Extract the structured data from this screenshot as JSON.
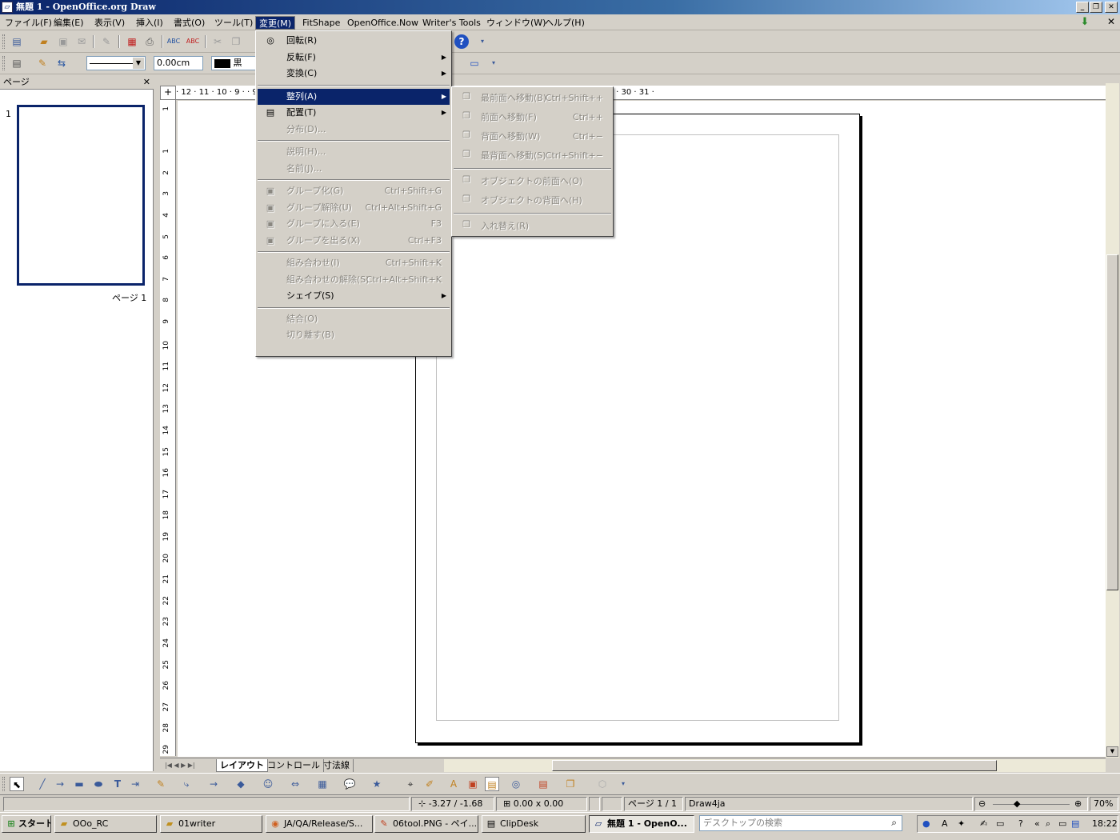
{
  "window": {
    "title": "無題 1 - OpenOffice.org Draw",
    "min": "_",
    "restore": "❐",
    "close": "✕",
    "doc_close": "✕"
  },
  "menubar": [
    "ファイル(F)",
    "編集(E)",
    "表示(V)",
    "挿入(I)",
    "書式(O)",
    "ツール(T)",
    "変更(M)",
    "FitShape",
    "OpenOffice.Now",
    "Writer's Tools",
    "ウィンドウ(W)",
    "ヘルプ(H)"
  ],
  "line_toolbar": {
    "line_width": "0.00cm",
    "color_name": "黒"
  },
  "page_panel": {
    "title": "ページ",
    "close": "✕",
    "page_number": "1",
    "page_label": "ページ 1"
  },
  "hruler": "· 12 · 11 · 10 · 9 ·          · 9 · 10 · 11 · 12 · 13 · 14 · 15 · 16 · 17 · 18 · 19 · 20 · 21 · 22 · 23 · 24 · 25 · 26 · 27 · 28 · 29 · 30 · 31 ·",
  "vruler": [
    "1",
    "",
    "1",
    "2",
    "3",
    "4",
    "5",
    "6",
    "7",
    "8",
    "9",
    "10",
    "11",
    "12",
    "13",
    "14",
    "15",
    "16",
    "17",
    "18",
    "19",
    "20",
    "21",
    "22",
    "23",
    "24",
    "25",
    "26",
    "27",
    "28",
    "29"
  ],
  "tabs": [
    "レイアウト",
    "コントロール",
    "寸法線"
  ],
  "modify_menu": [
    {
      "label": "回転(R)",
      "enabled": true,
      "icon": "◎"
    },
    {
      "label": "反転(F)",
      "enabled": true,
      "submenu": true
    },
    {
      "label": "変換(C)",
      "enabled": true,
      "submenu": true
    },
    {
      "sep": true
    },
    {
      "label": "整列(A)",
      "enabled": true,
      "submenu": true,
      "selected": true
    },
    {
      "label": "配置(T)",
      "enabled": true,
      "submenu": true,
      "icon": "▤"
    },
    {
      "label": "分布(D)...",
      "enabled": false
    },
    {
      "sep": true
    },
    {
      "label": "説明(H)...",
      "enabled": false
    },
    {
      "label": "名前(J)...",
      "enabled": false
    },
    {
      "sep": true
    },
    {
      "label": "グループ化(G)",
      "accel": "Ctrl+Shift+G",
      "enabled": false,
      "icon": "▣"
    },
    {
      "label": "グループ解除(U)",
      "accel": "Ctrl+Alt+Shift+G",
      "enabled": false,
      "icon": "▣"
    },
    {
      "label": "グループに入る(E)",
      "accel": "F3",
      "enabled": false,
      "icon": "▣"
    },
    {
      "label": "グループを出る(X)",
      "accel": "Ctrl+F3",
      "enabled": false,
      "icon": "▣"
    },
    {
      "sep": true
    },
    {
      "label": "組み合わせ(I)",
      "accel": "Ctrl+Shift+K",
      "enabled": false
    },
    {
      "label": "組み合わせの解除(S)",
      "accel": "Ctrl+Alt+Shift+K",
      "enabled": false
    },
    {
      "label": "シェイプ(S)",
      "enabled": true,
      "submenu": true
    },
    {
      "sep": true
    },
    {
      "label": "結合(O)",
      "enabled": false
    },
    {
      "label": "切り離す(B)",
      "enabled": false
    }
  ],
  "arrange_menu": [
    {
      "label": "最前面へ移動(B)",
      "accel": "Ctrl+Shift++",
      "enabled": false
    },
    {
      "label": "前面へ移動(F)",
      "accel": "Ctrl++",
      "enabled": false
    },
    {
      "label": "背面へ移動(W)",
      "accel": "Ctrl+−",
      "enabled": false
    },
    {
      "label": "最背面へ移動(S)",
      "accel": "Ctrl+Shift+−",
      "enabled": false
    },
    {
      "sep": true
    },
    {
      "label": "オブジェクトの前面へ(O)",
      "enabled": false
    },
    {
      "label": "オブジェクトの背面へ(H)",
      "enabled": false
    },
    {
      "sep": true
    },
    {
      "label": "入れ替え(R)",
      "enabled": false
    }
  ],
  "status": {
    "position": "-3.27 / -1.68",
    "size": "0.00 x 0.00",
    "page": "ページ 1 / 1",
    "style": "Draw4ja",
    "zoom": "70%"
  },
  "taskbar": {
    "start": "スタート",
    "tasks": [
      "OOo_RC",
      "01writer",
      "JA/QA/Release/S...",
      "06tool.PNG - ペイ...",
      "ClipDesk",
      "無題 1 - OpenO..."
    ],
    "search_placeholder": "デスクトップの検索",
    "clock": "18:22"
  }
}
